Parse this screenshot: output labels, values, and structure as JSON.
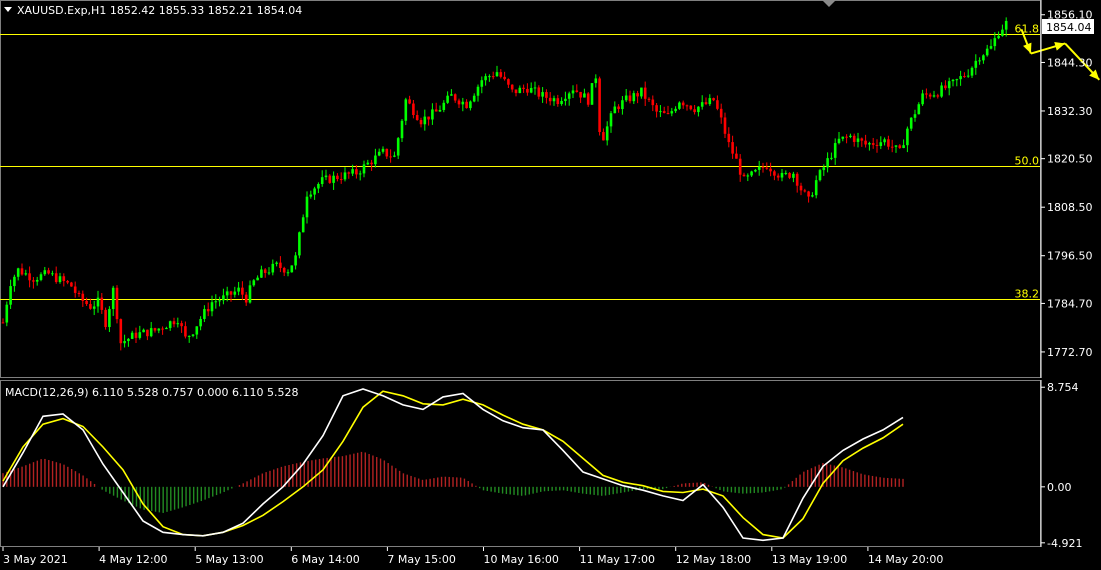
{
  "window": {
    "symbol_header": "XAUUSD.Exp,H1  1852.42 1855.33 1852.21 1854.04",
    "price_tag": "1854.04",
    "macd_header": "MACD(12,26,9) 6.110 5.528 0.757 0.000 6.110 5.528"
  },
  "colors": {
    "background": "#000000",
    "bull_candle": "#00ff00",
    "bear_candle": "#ff0000",
    "fib_line": "#ffff00",
    "macd_line": "#ffffff",
    "signal_line": "#ffff00",
    "hist_pos": "#b22222",
    "hist_neg": "#228b22",
    "axis": "#ffffff"
  },
  "chart_data": [
    {
      "type": "candlestick",
      "y_ticks": [
        "1856.10",
        "1844.30",
        "1832.30",
        "1820.50",
        "1808.50",
        "1796.50",
        "1784.70",
        "1772.70"
      ],
      "x_ticks": [
        "3 May 2021",
        "4 May 12:00",
        "5 May 13:00",
        "6 May 14:00",
        "7 May 15:00",
        "10 May 16:00",
        "11 May 17:00",
        "12 May 18:00",
        "13 May 19:00",
        "14 May 20:00"
      ],
      "ylim": [
        1766.5,
        1859.5
      ],
      "grid": false,
      "fib_levels": [
        {
          "label": "61.8",
          "value": 1851.3
        },
        {
          "label": "50.0",
          "value": 1818.8
        },
        {
          "label": "38.2",
          "value": 1785.9
        }
      ],
      "close_path": [
        [
          0,
          1780
        ],
        [
          2,
          1790
        ],
        [
          4,
          1793
        ],
        [
          8,
          1791
        ],
        [
          12,
          1792
        ],
        [
          16,
          1790
        ],
        [
          18,
          1789
        ],
        [
          20,
          1786
        ],
        [
          23,
          1784
        ],
        [
          25,
          1785
        ],
        [
          27,
          1780
        ],
        [
          29,
          1788
        ],
        [
          30,
          1782
        ],
        [
          31,
          1775
        ],
        [
          35,
          1777
        ],
        [
          40,
          1778
        ],
        [
          44,
          1780
        ],
        [
          46,
          1781
        ],
        [
          48,
          1776
        ],
        [
          50,
          1778
        ],
        [
          52,
          1781
        ],
        [
          55,
          1785
        ],
        [
          58,
          1786
        ],
        [
          62,
          1788
        ],
        [
          64,
          1786
        ],
        [
          66,
          1790
        ],
        [
          68,
          1792
        ],
        [
          72,
          1794
        ],
        [
          75,
          1793
        ],
        [
          77,
          1796
        ],
        [
          80,
          1812
        ],
        [
          84,
          1815
        ],
        [
          88,
          1816
        ],
        [
          93,
          1817
        ],
        [
          97,
          1820
        ],
        [
          100,
          1822
        ],
        [
          103,
          1821
        ],
        [
          106,
          1835
        ],
        [
          110,
          1830
        ],
        [
          114,
          1832
        ],
        [
          118,
          1836
        ],
        [
          122,
          1834
        ],
        [
          126,
          1840
        ],
        [
          130,
          1842
        ],
        [
          134,
          1837
        ],
        [
          138,
          1838
        ],
        [
          142,
          1836
        ],
        [
          146,
          1835
        ],
        [
          150,
          1838
        ],
        [
          154,
          1835
        ],
        [
          156,
          1841
        ],
        [
          157,
          1828
        ],
        [
          158,
          1826
        ],
        [
          161,
          1833
        ],
        [
          164,
          1835
        ],
        [
          168,
          1837
        ],
        [
          172,
          1832
        ],
        [
          175,
          1831
        ],
        [
          178,
          1835
        ],
        [
          182,
          1833
        ],
        [
          185,
          1834
        ],
        [
          187,
          1835
        ],
        [
          189,
          1830
        ],
        [
          191,
          1824
        ],
        [
          193,
          1820
        ],
        [
          195,
          1815
        ],
        [
          198,
          1817
        ],
        [
          201,
          1819
        ],
        [
          205,
          1816
        ],
        [
          208,
          1817
        ],
        [
          210,
          1813
        ],
        [
          212,
          1810
        ],
        [
          214,
          1815
        ],
        [
          217,
          1820
        ],
        [
          220,
          1825
        ],
        [
          223,
          1826
        ],
        [
          227,
          1824
        ],
        [
          232,
          1825
        ],
        [
          236,
          1822
        ],
        [
          238,
          1828
        ],
        [
          242,
          1836
        ],
        [
          246,
          1837
        ],
        [
          250,
          1839
        ],
        [
          254,
          1842
        ],
        [
          257,
          1846
        ],
        [
          260,
          1848
        ],
        [
          262,
          1852
        ],
        [
          264,
          1854
        ]
      ],
      "annotation_arrows": [
        [
          [
            268,
            1852.5
          ],
          [
            270.5,
            1846.5
          ]
        ],
        [
          [
            270.5,
            1846.5
          ],
          [
            279.5,
            1849
          ]
        ],
        [
          [
            279.5,
            1849
          ],
          [
            288.5,
            1840
          ]
        ]
      ]
    },
    {
      "type": "macd",
      "series": [
        {
          "name": "MACD",
          "values": [
            0,
            3,
            6.2,
            6.4,
            5,
            2,
            -0.5,
            -3,
            -4,
            -4.2,
            -4.3,
            -4,
            -3.2,
            -1.5,
            0,
            2,
            4.5,
            8,
            8.6,
            8,
            7.2,
            6.8,
            7.9,
            8.2,
            6.8,
            5.8,
            5.2,
            5,
            3.2,
            1.3,
            0.7,
            0.1,
            -0.3,
            -0.8,
            -1.2,
            0.2,
            -1.8,
            -4.5,
            -4.7,
            -4.5,
            -1,
            1.8,
            3.2,
            4.2,
            5,
            6.1
          ]
        },
        {
          "name": "Signal",
          "values": [
            0.5,
            3.5,
            5.5,
            6,
            5.3,
            3.5,
            1.5,
            -1.5,
            -3.5,
            -4.2,
            -4.3,
            -4,
            -3.4,
            -2.5,
            -1.3,
            0,
            1.5,
            4,
            7,
            8.4,
            8,
            7.3,
            7.2,
            7.7,
            7.2,
            6.3,
            5.5,
            5,
            4,
            2.5,
            1,
            0.4,
            0.1,
            -0.4,
            -0.5,
            -0.2,
            -0.8,
            -2.7,
            -4.2,
            -4.5,
            -2.8,
            0.3,
            2.3,
            3.4,
            4.3,
            5.5
          ]
        },
        {
          "name": "Histogram",
          "values": [
            1.2,
            1.8,
            2.5,
            2,
            1,
            -0.3,
            -1.2,
            -2,
            -2.3,
            -1.8,
            -1.2,
            -0.5,
            0.3,
            1.2,
            1.8,
            2.2,
            2.5,
            2.7,
            3.1,
            2.4,
            1.2,
            0.6,
            0.9,
            0.8,
            -0.3,
            -0.6,
            -0.8,
            -0.4,
            -0.3,
            -0.6,
            -0.8,
            -0.5,
            -0.2,
            -0.2,
            0.3,
            0.4,
            -0.4,
            -0.6,
            -0.5,
            -0.2,
            1.3,
            2.1,
            1.7,
            1.1,
            0.8,
            0.7
          ]
        }
      ],
      "y_ticks": [
        "8.754",
        "0.00",
        "-4.921"
      ],
      "ylim": [
        -5.2,
        9.3
      ],
      "grid": false
    }
  ]
}
